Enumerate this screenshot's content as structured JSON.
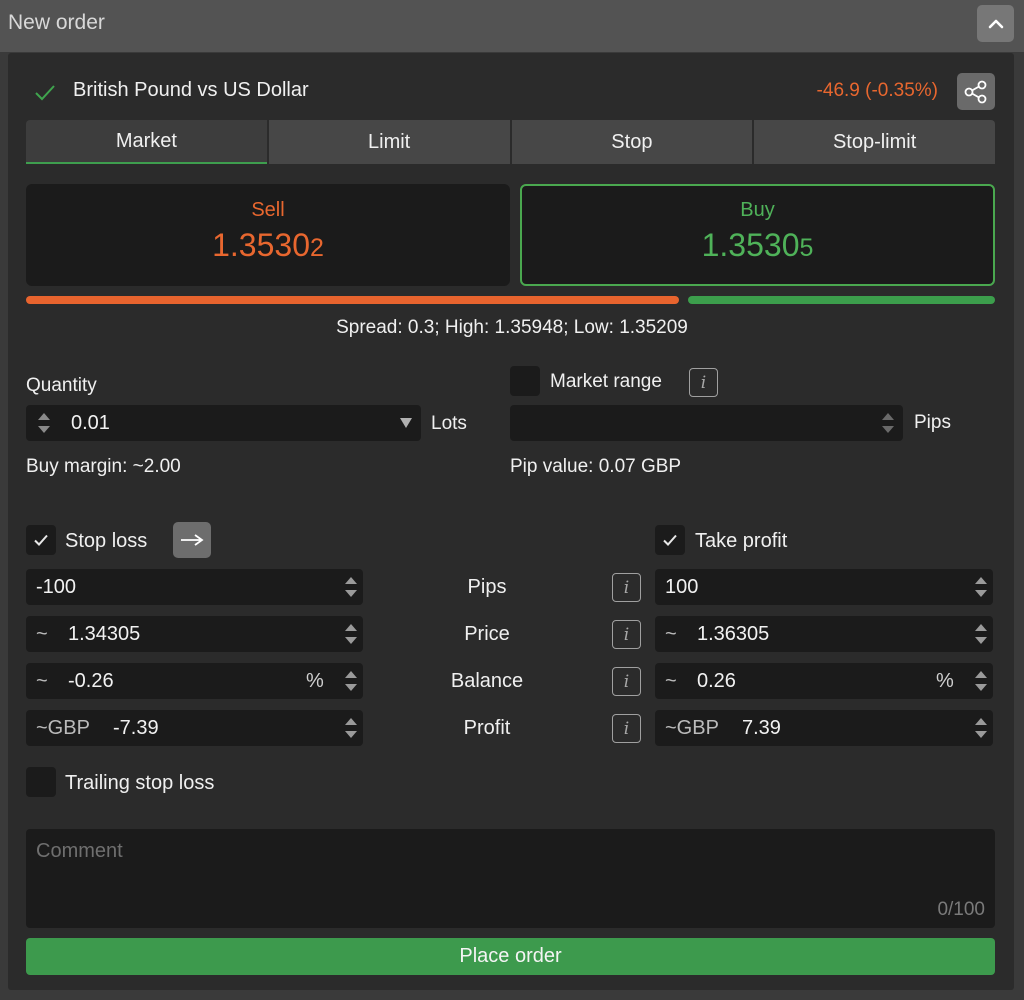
{
  "window": {
    "title": "New order"
  },
  "instrument": {
    "name": "British Pound vs US Dollar",
    "change": "-46.9 (-0.35%)"
  },
  "tabs": [
    {
      "label": "Market",
      "active": true
    },
    {
      "label": "Limit",
      "active": false
    },
    {
      "label": "Stop",
      "active": false
    },
    {
      "label": "Stop-limit",
      "active": false
    }
  ],
  "sell": {
    "label": "Sell",
    "price_main": "1.3530",
    "price_pip": "2",
    "color": "#e8672f"
  },
  "buy": {
    "label": "Buy",
    "price_main": "1.3530",
    "price_pip": "5",
    "color": "#4fb259"
  },
  "sentiment": {
    "sell_fraction": 0.68,
    "buy_fraction": 0.32
  },
  "market_info": "Spread: 0.3; High: 1.35948; Low: 1.35209",
  "quantity": {
    "label": "Quantity",
    "value": "0.01",
    "unit": "Lots",
    "margin": "Buy margin: ~2.00"
  },
  "market_range": {
    "label": "Market range",
    "value": "",
    "unit": "Pips",
    "pip_value": "Pip value: 0.07 GBP"
  },
  "stop_loss": {
    "label": "Stop loss",
    "checked": true,
    "pips": "-100",
    "price_prefix": "~",
    "price": "1.34305",
    "balance_prefix": "~",
    "balance": "-0.26",
    "balance_unit": "%",
    "profit_prefix": "~GBP",
    "profit": "-7.39"
  },
  "take_profit": {
    "label": "Take profit",
    "checked": true,
    "pips": "100",
    "price_prefix": "~",
    "price": "1.36305",
    "balance_prefix": "~",
    "balance": "0.26",
    "balance_unit": "%",
    "profit_prefix": "~GBP",
    "profit": "7.39"
  },
  "row_labels": {
    "pips": "Pips",
    "price": "Price",
    "balance": "Balance",
    "profit": "Profit"
  },
  "info_glyph": "i",
  "trailing_stop": {
    "label": "Trailing stop loss",
    "checked": false
  },
  "comment": {
    "placeholder": "Comment",
    "counter": "0/100"
  },
  "submit": {
    "label": "Place order"
  },
  "colors": {
    "accent_green": "#3d9a4d",
    "sell_orange": "#e8672f"
  }
}
